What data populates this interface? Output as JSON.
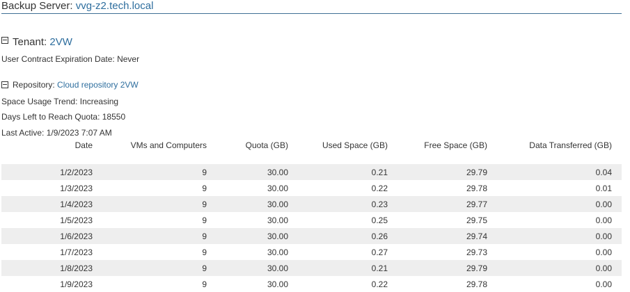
{
  "server": {
    "label": "Backup Server:",
    "name": "vvg-z2.tech.local"
  },
  "tenant": {
    "label": "Tenant:",
    "name": "2VW",
    "contract_expiration": "User Contract Expiration Date: Never"
  },
  "repository": {
    "label": "Repository:",
    "name": "Cloud repository 2VW",
    "usage_trend": "Space Usage Trend: Increasing",
    "days_left": "Days Left to Reach Quota: 18550",
    "last_active": "Last Active: 1/9/2023 7:07 AM"
  },
  "table": {
    "headers": [
      "Date",
      "VMs and Computers",
      "Quota (GB)",
      "Used Space (GB)",
      "Free Space (GB)",
      "Data Transferred (GB)"
    ],
    "rows": [
      [
        "1/2/2023",
        "9",
        "30.00",
        "0.21",
        "29.79",
        "0.04"
      ],
      [
        "1/3/2023",
        "9",
        "30.00",
        "0.22",
        "29.78",
        "0.01"
      ],
      [
        "1/4/2023",
        "9",
        "30.00",
        "0.23",
        "29.77",
        "0.00"
      ],
      [
        "1/5/2023",
        "9",
        "30.00",
        "0.25",
        "29.75",
        "0.00"
      ],
      [
        "1/6/2023",
        "9",
        "30.00",
        "0.26",
        "29.74",
        "0.00"
      ],
      [
        "1/7/2023",
        "9",
        "30.00",
        "0.27",
        "29.73",
        "0.00"
      ],
      [
        "1/8/2023",
        "9",
        "30.00",
        "0.21",
        "29.79",
        "0.00"
      ],
      [
        "1/9/2023",
        "9",
        "30.00",
        "0.22",
        "29.78",
        "0.00"
      ]
    ]
  },
  "colors": {
    "link": "#2e6e9e",
    "header_rule": "#3f6f94",
    "row_stripe": "#eeeeee",
    "text": "#333333"
  },
  "icons": {
    "collapse": "minus-box-icon"
  }
}
